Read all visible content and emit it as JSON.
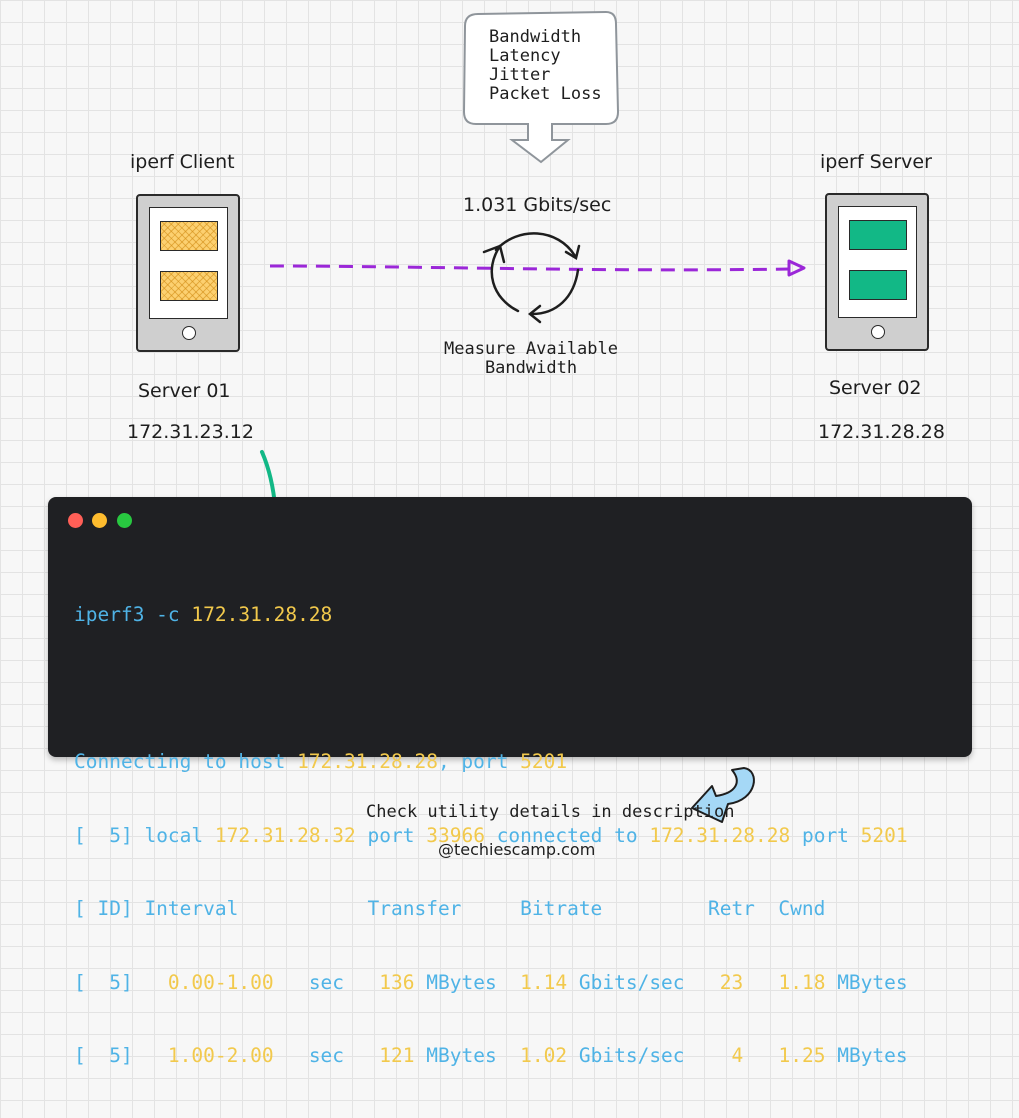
{
  "callout": {
    "lines": [
      "Bandwidth",
      "Latency",
      "Jitter",
      "Packet Loss"
    ]
  },
  "client": {
    "title": "iperf Client",
    "server_name": "Server 01",
    "ip": "172.31.23.12"
  },
  "server": {
    "title": "iperf Server",
    "server_name": "Server 02",
    "ip": "172.31.28.28"
  },
  "measurement": {
    "rate": "1.031 Gbits/sec",
    "caption_line1": "Measure Available",
    "caption_line2": "Bandwidth"
  },
  "terminal": {
    "command": {
      "cmd": "iperf3 -c ",
      "target": "172.31.28.28"
    },
    "connecting": {
      "prefix": "Connecting to host ",
      "host": "172.31.28.28",
      "mid": ", port ",
      "port": "5201"
    },
    "local_line": {
      "bracket": "[  5] ",
      "local": "local ",
      "local_ip": "172.31.28.32",
      "port_word": " port ",
      "local_port": "33966",
      "connected": " connected to ",
      "remote_ip": "172.31.28.28",
      "port_word2": " port ",
      "remote_port": "5201"
    },
    "header": "[ ID] Interval           Transfer     Bitrate         Retr  Cwnd",
    "rows": [
      {
        "bracket": "[  5]   ",
        "interval": "0.00-1.00",
        "sec": "   sec   ",
        "transfer": "136",
        "t_unit": " MBytes  ",
        "bitrate": "1.14",
        "b_unit": " Gbits/sec   ",
        "retr": "23",
        "sp": "   ",
        "cwnd": "1.18",
        "c_unit": " MBytes"
      },
      {
        "bracket": "[  5]   ",
        "interval": "1.00-2.00",
        "sec": "   sec   ",
        "transfer": "121",
        "t_unit": " MBytes  ",
        "bitrate": "1.02",
        "b_unit": " Gbits/sec    ",
        "retr": "4",
        "sp": "   ",
        "cwnd": "1.25",
        "c_unit": " MBytes"
      }
    ]
  },
  "footer": {
    "note": "Check utility details in description",
    "handle": "@techiescamp.com"
  },
  "colors": {
    "dashed_arrow": "#9b27d8",
    "green_arrow": "#12b886",
    "curved_arrow": "#9fd3f2",
    "terminal_blue": "#4fb3e6",
    "terminal_yellow": "#f2c94c",
    "dot_red": "#ff5f57",
    "dot_yellow": "#febc2e",
    "dot_green": "#28c840"
  }
}
